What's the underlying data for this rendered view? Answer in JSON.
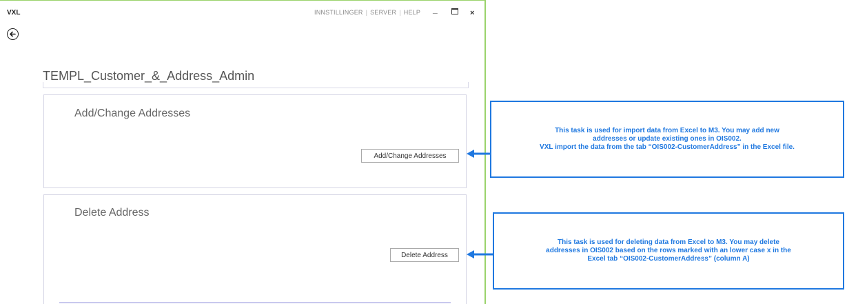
{
  "window": {
    "app_title": "VXL",
    "nav": {
      "settings": "INNSTILLINGER",
      "server": "SERVER",
      "help": "HELP",
      "separator": "|"
    },
    "controls": {
      "minimize": "_",
      "close": "×"
    }
  },
  "page": {
    "title": "TEMPL_Customer_&_Address_Admin"
  },
  "tasks": [
    {
      "title": "Add/Change Addresses",
      "button_label": "Add/Change Addresses"
    },
    {
      "title": "Delete Address",
      "button_label": "Delete Address"
    }
  ],
  "callouts": [
    {
      "lines": [
        "This task is used for import data from Excel to M3. You may add new",
        "addresses or update existing ones in OIS002.",
        "VXL import the data from the tab “OIS002-CustomerAddress” in the Excel file."
      ]
    },
    {
      "lines": [
        "This task is used for deleting data from Excel to M3. You may delete",
        "addresses in OIS002 based on the rows marked with an lower case x in the",
        "Excel tab “OIS002-CustomerAddress” (column A)"
      ]
    }
  ],
  "colors": {
    "window_border": "#9ad36b",
    "callout_accent": "#1f78e0",
    "panel_border": "#d4d4e4"
  }
}
